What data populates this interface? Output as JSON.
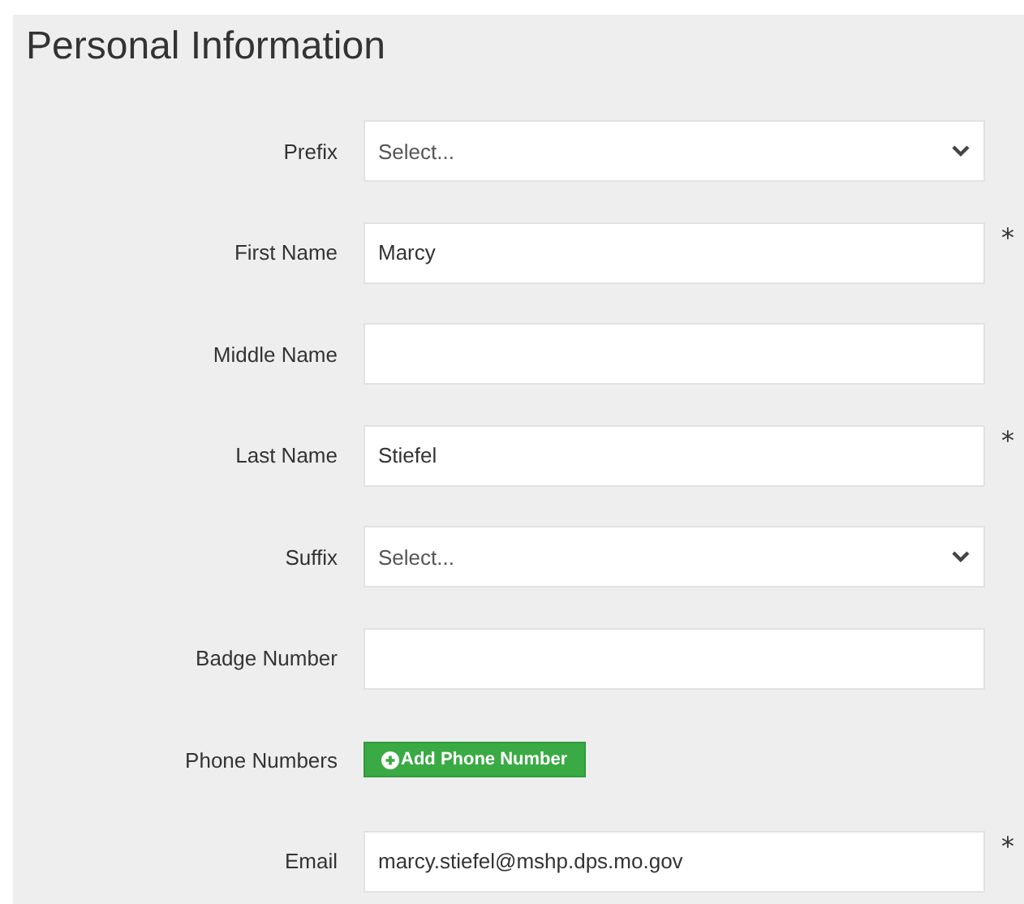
{
  "section": {
    "title": "Personal Information"
  },
  "fields": [
    {
      "kind": "select",
      "label": "Prefix",
      "value": "Select..."
    },
    {
      "kind": "text",
      "label": "First Name",
      "value": "Marcy",
      "required_mark": "*"
    },
    {
      "kind": "text",
      "label": "Middle Name"
    },
    {
      "kind": "text",
      "label": "Last Name",
      "value": "Stiefel",
      "required_mark": "*"
    },
    {
      "kind": "select",
      "label": "Suffix",
      "value": "Select..."
    },
    {
      "kind": "text",
      "label": "Badge Number"
    },
    {
      "kind": "button",
      "label": "Phone Numbers",
      "button": "Add Phone Number"
    },
    {
      "kind": "text",
      "label": "Email",
      "value": "marcy.stiefel@mshp.dps.mo.gov",
      "required_mark": "*"
    }
  ]
}
